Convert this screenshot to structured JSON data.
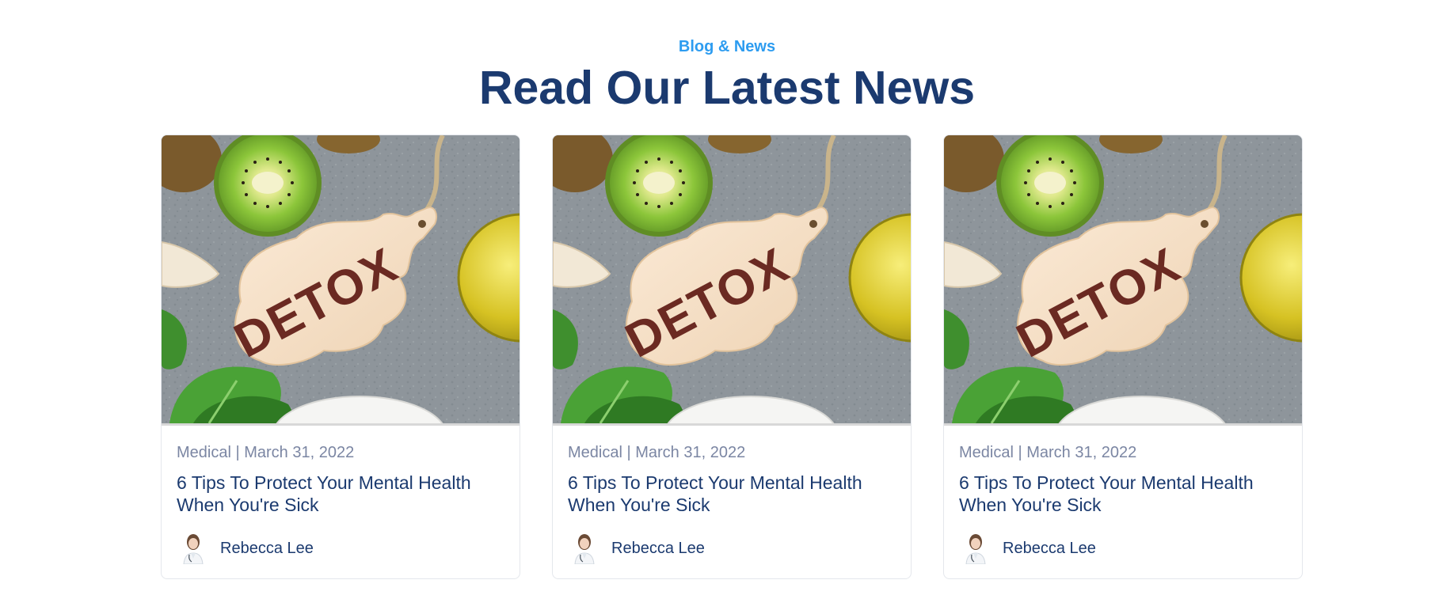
{
  "section": {
    "eyebrow": "Blog & News",
    "heading": "Read Our Latest News"
  },
  "posts": [
    {
      "image_alt": "DETOX",
      "category": "Medical",
      "date": "March 31, 2022",
      "meta": "Medical | March 31, 2022",
      "title": "6 Tips To Protect Your Mental Health When You're Sick",
      "author": "Rebecca Lee"
    },
    {
      "image_alt": "DETOX",
      "category": "Medical",
      "date": "March 31, 2022",
      "meta": "Medical | March 31, 2022",
      "title": "6 Tips To Protect Your Mental Health When You're Sick",
      "author": "Rebecca Lee"
    },
    {
      "image_alt": "DETOX",
      "category": "Medical",
      "date": "March 31, 2022",
      "meta": "Medical | March 31, 2022",
      "title": "6 Tips To Protect Your Mental Health When You're Sick",
      "author": "Rebecca Lee"
    }
  ],
  "colors": {
    "accent": "#2d9cf0",
    "heading": "#1b3a6f",
    "meta": "#7b86a3"
  }
}
